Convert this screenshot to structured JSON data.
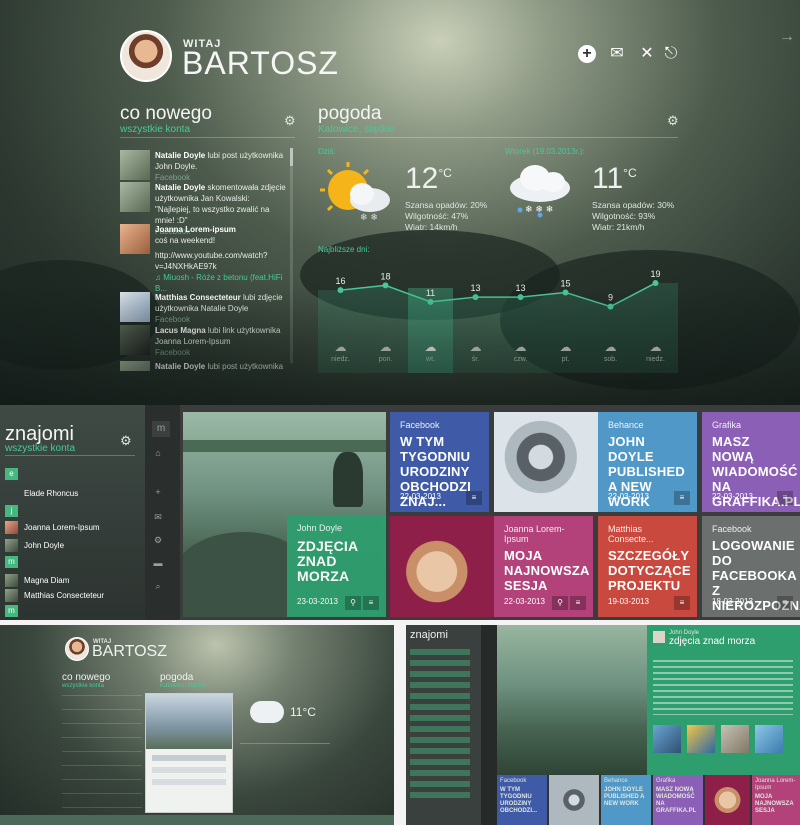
{
  "greeting": {
    "small": "WITAJ",
    "name": "BARTOSZ"
  },
  "news": {
    "title": "co nowego",
    "subtitle": "wszystkie konta",
    "items": [
      {
        "name": "Natalie Doyle",
        "text": " lubi post użytkownika John Doyle.",
        "source": "Facebook"
      },
      {
        "name": "Natalie Doyle",
        "text": " skomentowała zdjęcie użytkownika Jan Kowalski: \"Najlepiej, to wszystko zwalić na mnie! :D\"",
        "source": "Facebook"
      },
      {
        "name": "Joanna Lorem-ipsum",
        "text": "coś na weekend!",
        "link": "http://www.youtube.com/watch?v=J4NXHkAE97k",
        "song": "Miuosh - Róże z betonu (feat.HiFi B...",
        "source": ""
      },
      {
        "name": "Matthias Consecteteur",
        "text": " lubi zdjęcie użytkownika Natalie Doyle",
        "source": "Facebook"
      },
      {
        "name": "Lacus Magna",
        "text": " lubi link użytkownika Joanna Lorem-Ipsum",
        "source": "Facebook"
      },
      {
        "name": "Natalie Doyle",
        "text": " lubi post użytkownika John",
        "source": ""
      }
    ]
  },
  "weather": {
    "title": "pogoda",
    "location": "Katowice, śląskie",
    "today": {
      "label": "Dziś:",
      "temp": "12",
      "unit": "°C",
      "rain": "Szansa opadów: 20%",
      "humidity": "Wilgotność: 47%",
      "wind": "Wiatr: 14km/h"
    },
    "tomorrow": {
      "label": "Wtorek (19.03.2013r.):",
      "temp": "11",
      "unit": "°C",
      "rain": "Szansa opadów: 30%",
      "humidity": "Wilgotność: 93%",
      "wind": "Wiatr: 21km/h"
    },
    "upcoming_label": "Najbliższe dni:",
    "days": [
      {
        "day": "niedz.",
        "temp": 16
      },
      {
        "day": "pon.",
        "temp": 18
      },
      {
        "day": "wt.",
        "temp": 11
      },
      {
        "day": "śr.",
        "temp": 13
      },
      {
        "day": "czw.",
        "temp": 13
      },
      {
        "day": "pt.",
        "temp": 15
      },
      {
        "day": "sob.",
        "temp": 9
      },
      {
        "day": "niedz.",
        "temp": 19
      }
    ]
  },
  "friends": {
    "title": "znajomi",
    "subtitle": "wszystkie konta",
    "letters": [
      "e",
      "j",
      "m",
      "m"
    ],
    "names": [
      "Elade Rhoncus",
      "Joanna Lorem-Ipsum",
      "John Doyle",
      "Magna Diam",
      "Matthias Consecteteur"
    ]
  },
  "tiles": [
    {
      "cat": "John Doyle",
      "title": "ZDJĘCIA ZNAD MORZA",
      "date": "23-03-2013",
      "color": "#2f9e6e"
    },
    {
      "cat": "Facebook",
      "title": "W TYM TYGODNIU URODZINY OBCHODZI ZNAJ...",
      "date": "22-03-2013",
      "color": "#3f5ba8"
    },
    {
      "cat": "Behance",
      "title": "JOHN DOYLE PUBLISHED A NEW WORK",
      "date": "22-03-2013",
      "color": "#4f98c7"
    },
    {
      "cat": "Grafika",
      "title": "MASZ NOWĄ WIADOMOŚĆ NA GRAFFIKA.PL",
      "date": "22-03-2013",
      "color": "#8b5fb5"
    },
    {
      "cat": "Joanna Lorem-Ipsum",
      "title": "MOJA NAJNOWSZA SESJA",
      "date": "22-03-2013",
      "color": "#b3427a"
    },
    {
      "cat": "Matthias Consecte...",
      "title": "SZCZEGÓŁY DOTYCZĄCE PROJEKTU",
      "date": "19-03-2013",
      "color": "#c9493e"
    },
    {
      "cat": "Facebook",
      "title": "LOGOWANIE DO FACEBOOKA Z NIEROZPOZNANE...",
      "date": "18-03-2013",
      "color": "#6b6f6d"
    }
  ],
  "sidebar_icon": "m",
  "preview_left": {
    "small": "WITAJ",
    "name": "BARTOSZ",
    "news": "co nowego",
    "news_sub": "wszystkie konta",
    "weather": "pogoda",
    "weather_loc": "Katowice, śląskie",
    "temp": "11°C"
  },
  "preview_right": {
    "friends": "znajomi",
    "author": "John Doyle",
    "title": "zdjęcia znad morza",
    "tiles": [
      {
        "cat": "Facebook",
        "title": "W TYM TYGODNIU URODZINY OBCHODZI...",
        "color": "#3f5ba8"
      },
      {
        "cat": "Behance",
        "title": "JOHN DOYLE PUBLISHED A NEW WORK",
        "color": "#4f98c7"
      },
      {
        "cat": "Grafika",
        "title": "MASZ NOWĄ WIADOMOŚĆ NA GRAFFIKA.PL",
        "color": "#8b5fb5"
      },
      {
        "cat": "Joanna Lorem-Ipsum",
        "title": "MOJA NAJNOWSZA SESJA",
        "color": "#b3427a"
      }
    ]
  }
}
